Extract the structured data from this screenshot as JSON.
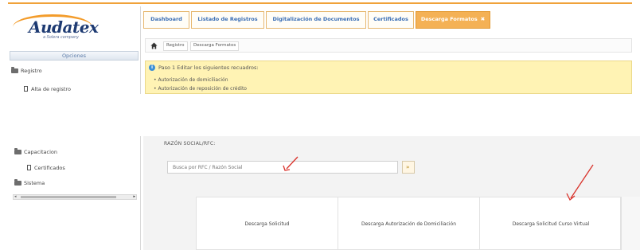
{
  "brand": {
    "logo_text": "Audatex",
    "logo_subtitle": "a Solera company"
  },
  "sidebar": {
    "header": "Opciones",
    "items_top": [
      {
        "label": "Registro",
        "icon": "folder-icon"
      },
      {
        "label": "Alta de registro",
        "icon": "document-icon"
      }
    ],
    "items_bottom": [
      {
        "label": "Capacitacion",
        "icon": "folder-icon"
      },
      {
        "label": "Certificados",
        "icon": "document-icon"
      },
      {
        "label": "Sistema",
        "icon": "folder-icon"
      }
    ]
  },
  "tabs": [
    {
      "label": "Dashboard",
      "active": false
    },
    {
      "label": "Listado de Registros",
      "active": false
    },
    {
      "label": "Digitalización de Documentos",
      "active": false
    },
    {
      "label": "Certificados",
      "active": false
    },
    {
      "label": "Descarga Formatos",
      "active": true,
      "close": "✖"
    }
  ],
  "breadcrumb": [
    "Registro",
    "Descarga Formatos"
  ],
  "alert": {
    "title": "Paso 1   Editar los siguientes recuadros:",
    "items": [
      "Autorización de domiciliación",
      "Autorización de reposición de crédito"
    ]
  },
  "form": {
    "field_label": "RAZÓN SOCIAL/RFC:",
    "search_placeholder": "Busca por RFC / Razón Social",
    "search_button": "»"
  },
  "downloads": [
    "Descarga Solicitud",
    "Descarga Autorización de Domiciliación",
    "Descarga Solicitud Curso Virtual"
  ],
  "colors": {
    "accent_orange": "#f4b155",
    "link_blue": "#3a6eb5",
    "alert_yellow": "#fff3b4",
    "annotation_red": "#d9322b"
  }
}
